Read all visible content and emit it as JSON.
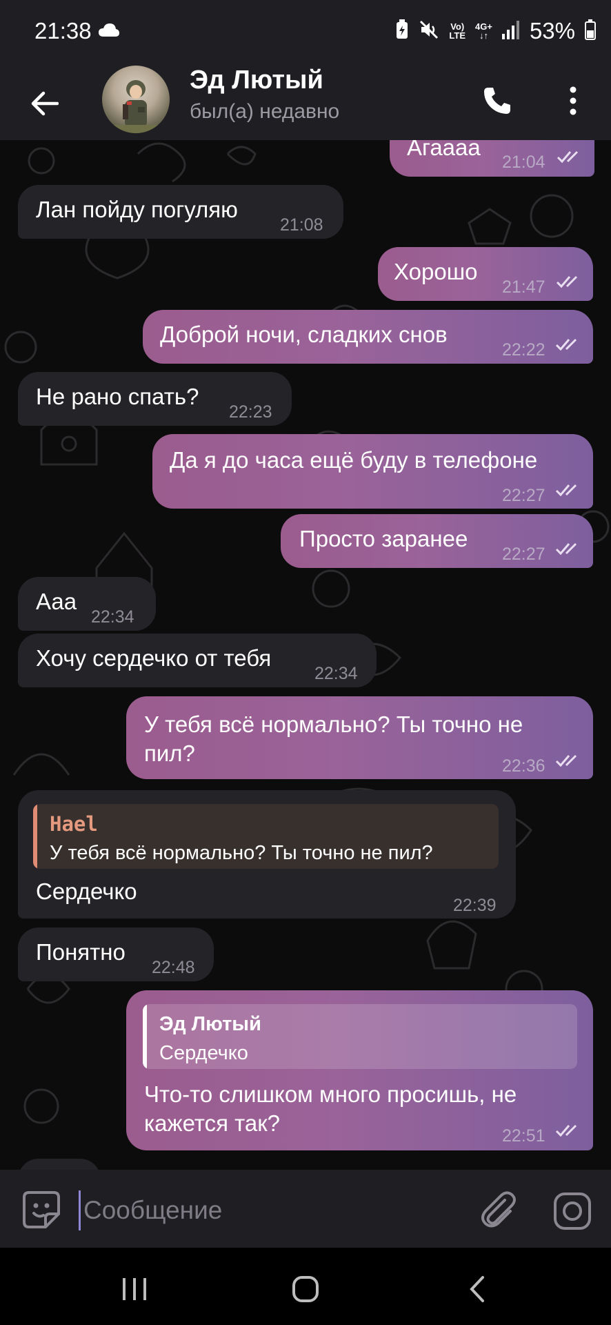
{
  "status_bar": {
    "time": "21:38",
    "volte_top": "Vo)",
    "volte_bottom": "LTE",
    "network_top": "4G+",
    "network_bottom": "↓↑",
    "battery": "53%"
  },
  "header": {
    "name": "Эд Лютый",
    "status": "был(а) недавно"
  },
  "messages": [
    {
      "side": "out",
      "text": "Агаааа",
      "time": "21:04",
      "ticks": "double"
    },
    {
      "side": "in",
      "text": "Лан пойду погуляю",
      "time": "21:08"
    },
    {
      "side": "out",
      "text": "Хорошо",
      "time": "21:47",
      "ticks": "double"
    },
    {
      "side": "out",
      "text": "Доброй ночи, сладких снов",
      "time": "22:22",
      "ticks": "double"
    },
    {
      "side": "in",
      "text": "Не рано спать?",
      "time": "22:23"
    },
    {
      "side": "out",
      "text": "Да я до часа ещё буду в телефоне",
      "time": "22:27",
      "ticks": "double"
    },
    {
      "side": "out",
      "text": "Просто заранее",
      "time": "22:27",
      "ticks": "double"
    },
    {
      "side": "in",
      "text": "Ааа",
      "time": "22:34"
    },
    {
      "side": "in",
      "text": "Хочу сердечко от тебя",
      "time": "22:34"
    },
    {
      "side": "out",
      "text_line1": "У тебя всё нормально? Ты точно не",
      "text_line2": "пил?",
      "time": "22:36",
      "ticks": "double"
    },
    {
      "side": "in",
      "reply_name": "Hael",
      "reply_text": "У тебя всё нормально? Ты точно не пил?",
      "text": "Сердечко",
      "time": "22:39"
    },
    {
      "side": "in",
      "text": "Понятно",
      "time": "22:48"
    },
    {
      "side": "out",
      "reply_name": "Эд Лютый",
      "reply_text": "Сердечко",
      "text_line1": "Что-то слишком много просишь, не",
      "text_line2": "кажется так?",
      "time": "22:51",
      "ticks": "double"
    }
  ],
  "input": {
    "placeholder": "Сообщение",
    "value": ""
  },
  "colors": {
    "incoming_bubble": "#242328",
    "outgoing_start": "#9b5c8e",
    "outgoing_end": "#7e5f9e",
    "reply_name_incoming": "#e59a7f",
    "reply_bar_incoming": "#e08b74",
    "caret": "#8f86d6"
  },
  "icons": {
    "back": "arrow-left-icon",
    "call": "phone-icon",
    "menu": "more-vertical-icon",
    "emoji": "sticker-smile-icon",
    "attach": "paperclip-icon",
    "camera": "instagram-camera-icon"
  }
}
